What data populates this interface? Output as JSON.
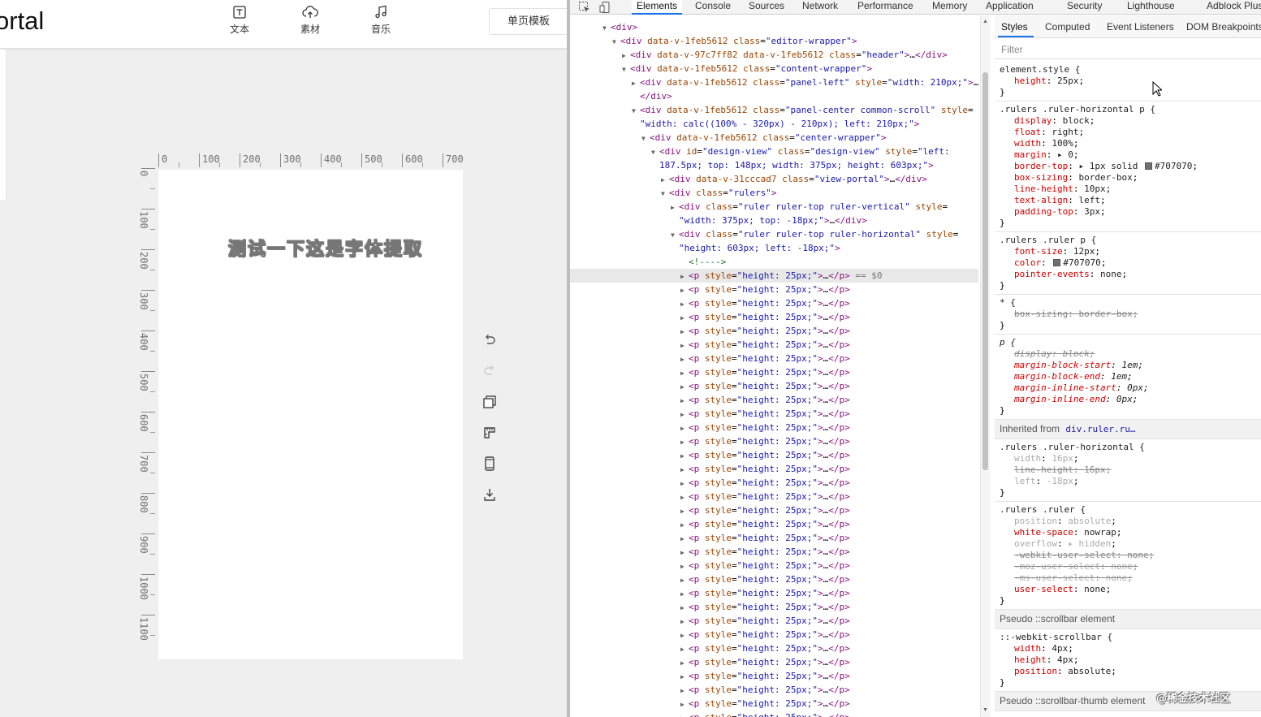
{
  "editor": {
    "brand": "ortal",
    "tools": [
      {
        "label": "文本",
        "icon": "text-icon"
      },
      {
        "label": "素材",
        "icon": "cloud-upload-icon"
      },
      {
        "label": "音乐",
        "icon": "music-note-icon"
      }
    ],
    "template_button": "单页模板",
    "ruler_h_labels": [
      "0",
      "100",
      "200",
      "300",
      "400",
      "500",
      "600",
      "700"
    ],
    "ruler_v_labels": [
      "0",
      "100",
      "200",
      "300",
      "400",
      "500",
      "600",
      "700",
      "800",
      "900",
      "1000",
      "1100"
    ],
    "canvas_text": "测试一下这是字体提取",
    "side_tools": [
      "undo-icon",
      "redo-icon",
      "copy-icon",
      "ruler-icon",
      "mobile-preview-icon",
      "download-icon"
    ]
  },
  "devtools": {
    "tabs": [
      "Elements",
      "Console",
      "Sources",
      "Network",
      "Performance",
      "Memory",
      "Application",
      "Security",
      "Lighthouse",
      "Adblock Plus"
    ],
    "active_tab": "Elements",
    "dom_lines": [
      {
        "indent": 0,
        "tw": "▼",
        "html": "<span class='t-tag'>&lt;div&gt;</span>"
      },
      {
        "indent": 1,
        "tw": "▼",
        "html": "<span class='t-tag'>&lt;div</span> <span class='t-attr'>data-v-1feb5612</span> <span class='t-attr'>class</span>=<span class='t-val'>\"editor-wrapper\"</span><span class='t-tag'>&gt;</span>"
      },
      {
        "indent": 2,
        "tw": "▶",
        "html": "<span class='t-tag'>&lt;div</span> <span class='t-attr'>data-v-97c7ff82</span> <span class='t-attr'>data-v-1feb5612</span> <span class='t-attr'>class</span>=<span class='t-val'>\"header\"</span><span class='t-tag'>&gt;</span>…<span class='t-tag'>&lt;/div&gt;</span>"
      },
      {
        "indent": 2,
        "tw": "▼",
        "html": "<span class='t-tag'>&lt;div</span> <span class='t-attr'>data-v-1feb5612</span> <span class='t-attr'>class</span>=<span class='t-val'>\"content-wrapper\"</span><span class='t-tag'>&gt;</span>"
      },
      {
        "indent": 3,
        "tw": "▶",
        "html": "<span class='t-tag'>&lt;div</span> <span class='t-attr'>data-v-1feb5612</span> <span class='t-attr'>class</span>=<span class='t-val'>\"panel-left\"</span> <span class='t-attr'>style</span>=<span class='t-val'>\"width: 210px;\"</span><span class='t-tag'>&gt;</span>…"
      },
      {
        "indent": 3,
        "tw": "",
        "html": "<span class='t-tag'>&lt;/div&gt;</span>"
      },
      {
        "indent": 3,
        "tw": "▼",
        "html": "<span class='t-tag'>&lt;div</span> <span class='t-attr'>data-v-1feb5612</span> <span class='t-attr'>class</span>=<span class='t-val'>\"panel-center common-scroll\"</span> <span class='t-attr'>style</span>="
      },
      {
        "indent": 3,
        "tw": "",
        "html": "<span class='t-val'>\"width: calc((100% - 320px) - 210px); left: 210px;\"</span><span class='t-tag'>&gt;</span>"
      },
      {
        "indent": 4,
        "tw": "▼",
        "html": "<span class='t-tag'>&lt;div</span> <span class='t-attr'>data-v-1feb5612</span> <span class='t-attr'>class</span>=<span class='t-val'>\"center-wrapper\"</span><span class='t-tag'>&gt;</span>"
      },
      {
        "indent": 5,
        "tw": "▼",
        "html": "<span class='t-tag'>&lt;div</span> <span class='t-attr'>id</span>=<span class='t-val'>\"design-view\"</span> <span class='t-attr'>class</span>=<span class='t-val'>\"design-view\"</span> <span class='t-attr'>style</span>=<span class='t-val'>\"left:</span>"
      },
      {
        "indent": 5,
        "tw": "",
        "html": "<span class='t-val'>187.5px; top: 148px; width: 375px; height: 603px;\"</span><span class='t-tag'>&gt;</span>"
      },
      {
        "indent": 6,
        "tw": "▶",
        "html": "<span class='t-tag'>&lt;div</span> <span class='t-attr'>data-v-31cccad7</span> <span class='t-attr'>class</span>=<span class='t-val'>\"view-portal\"</span><span class='t-tag'>&gt;</span>…<span class='t-tag'>&lt;/div&gt;</span>"
      },
      {
        "indent": 6,
        "tw": "▼",
        "html": "<span class='t-tag'>&lt;div</span> <span class='t-attr'>class</span>=<span class='t-val'>\"rulers\"</span><span class='t-tag'>&gt;</span>"
      },
      {
        "indent": 7,
        "tw": "▶",
        "html": "<span class='t-tag'>&lt;div</span> <span class='t-attr'>class</span>=<span class='t-val'>\"ruler ruler-top ruler-vertical\"</span> <span class='t-attr'>style</span>="
      },
      {
        "indent": 7,
        "tw": "",
        "html": "<span class='t-val'>\"width: 375px; top: -18px;\"</span><span class='t-tag'>&gt;</span>…<span class='t-tag'>&lt;/div&gt;</span>"
      },
      {
        "indent": 7,
        "tw": "▼",
        "html": "<span class='t-tag'>&lt;div</span> <span class='t-attr'>class</span>=<span class='t-val'>\"ruler ruler-top ruler-horizontal\"</span> <span class='t-attr'>style</span>="
      },
      {
        "indent": 7,
        "tw": "",
        "html": "<span class='t-val'>\"height: 603px; left: -18px;\"</span><span class='t-tag'>&gt;</span>"
      },
      {
        "indent": 8,
        "tw": "",
        "html": "<span class='t-com'>&lt;!----&gt;</span>"
      },
      {
        "indent": 8,
        "tw": "▶",
        "sel": true,
        "html": "<span class='t-tag'>&lt;p</span> <span class='t-attr'>style</span>=<span class='t-val'>\"height: 25px;\"</span><span class='t-tag'>&gt;</span>…<span class='t-tag'>&lt;/p&gt;</span> <span class='t-dim'>== $0</span>"
      }
    ],
    "p_line": "<span class='t-tag'>&lt;p</span> <span class='t-attr'>style</span>=<span class='t-val'>\"height: 25px;\"</span><span class='t-tag'>&gt;</span>…<span class='t-tag'>&lt;/p&gt;</span>",
    "p_line_count": 33,
    "styles": {
      "tabs": [
        "Styles",
        "Computed",
        "Event Listeners",
        "DOM Breakpoints"
      ],
      "filter_placeholder": "Filter",
      "inherited_label": "Inherited from",
      "inherited_link": "div.ruler.ru…",
      "pseudo_scrollbar": "Pseudo ::scrollbar element",
      "pseudo_thumb": "Pseudo ::scrollbar-thumb element"
    }
  },
  "watermark": "@稀金技术社区"
}
